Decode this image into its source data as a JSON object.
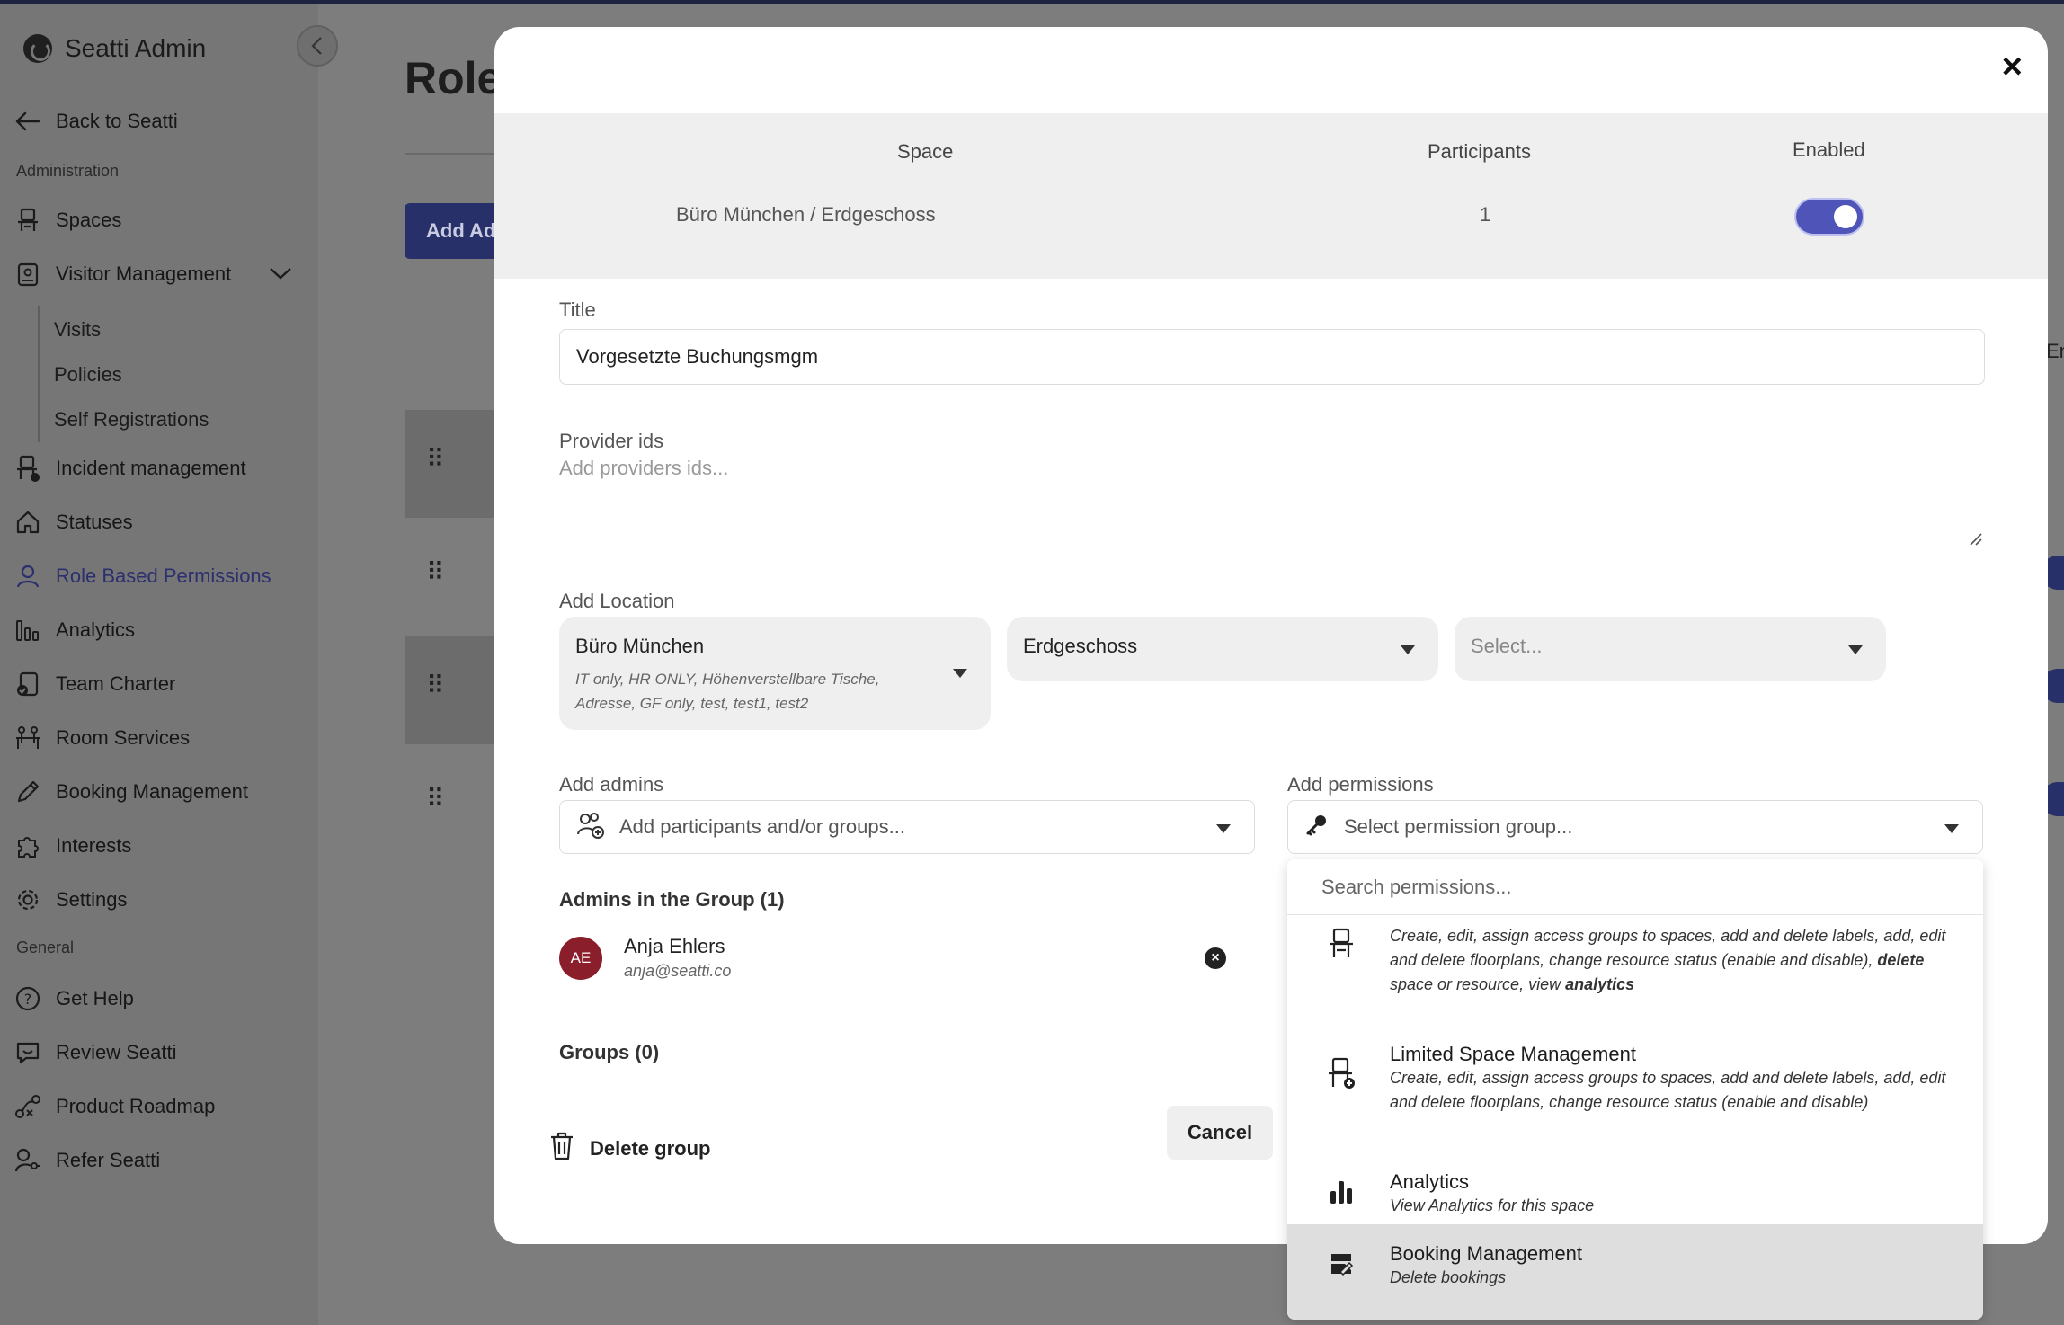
{
  "app": {
    "name": "Seatti Admin"
  },
  "sidebar": {
    "back_label": "Back to Seatti",
    "section_admin": "Administration",
    "section_general": "General",
    "items": {
      "spaces": "Spaces",
      "visitor_management": "Visitor Management",
      "visits": "Visits",
      "policies": "Policies",
      "self_registrations": "Self Registrations",
      "incident_management": "Incident management",
      "statuses": "Statuses",
      "role_based_permissions": "Role Based Permissions",
      "analytics": "Analytics",
      "team_charter": "Team Charter",
      "room_services": "Room Services",
      "booking_management": "Booking Management",
      "interests": "Interests",
      "settings": "Settings",
      "get_help": "Get Help",
      "review_seatti": "Review Seatti",
      "product_roadmap": "Product Roadmap",
      "refer_seatti": "Refer Seatti"
    }
  },
  "background_page": {
    "title": "Role",
    "add_button": "Add Ad",
    "right_header": "En"
  },
  "modal": {
    "close_label": "×",
    "space_table": {
      "headers": {
        "space": "Space",
        "participants": "Participants",
        "enabled": "Enabled"
      },
      "row": {
        "space": "Büro München / Erdgeschoss",
        "participants": "1",
        "enabled": true
      }
    },
    "title_label": "Title",
    "title_value": "Vorgesetzte Buchungsmgm",
    "provider_label": "Provider ids",
    "provider_placeholder": "Add providers ids...",
    "location_label": "Add Location",
    "location": {
      "building": "Büro München",
      "building_tags": "IT only, HR ONLY, Höhenverstellbare Tische, Adresse, GF only, test, test1, test2",
      "floor": "Erdgeschoss",
      "area_placeholder": "Select..."
    },
    "admins_label": "Add admins",
    "admins_placeholder": "Add participants and/or groups...",
    "permissions_label": "Add permissions",
    "permissions_placeholder": "Select permission group...",
    "admins_in_group": "Admins in the Group (1)",
    "admin": {
      "initials": "AE",
      "name": "Anja Ehlers",
      "email": "anja@seatti.co"
    },
    "groups_label": "Groups (0)",
    "delete_group": "Delete group",
    "cancel": "Cancel"
  },
  "permissions_dropdown": {
    "search_placeholder": "Search permissions...",
    "options": [
      {
        "title": "",
        "desc_prefix": "Create, edit, assign access groups to spaces, add and delete labels, add, edit and delete floorplans, change resource status (enable and disable), ",
        "desc_bold1": "delete",
        "desc_mid": " space or resource, view ",
        "desc_bold2": "analytics",
        "icon": "desk-icon"
      },
      {
        "title": "Limited Space Management",
        "desc": "Create, edit, assign access groups to spaces, add and delete labels, add, edit and delete floorplans, change resource status (enable and disable)",
        "icon": "desk-plus-icon"
      },
      {
        "title": "Analytics",
        "desc": "View Analytics for this space",
        "icon": "bar-chart-icon"
      },
      {
        "title": "Booking Management",
        "desc": "Delete bookings",
        "icon": "booking-icon"
      }
    ]
  },
  "colors": {
    "accent": "#4f55b8",
    "active_nav": "#2b2f6e",
    "avatar": "#8b1e2b"
  }
}
